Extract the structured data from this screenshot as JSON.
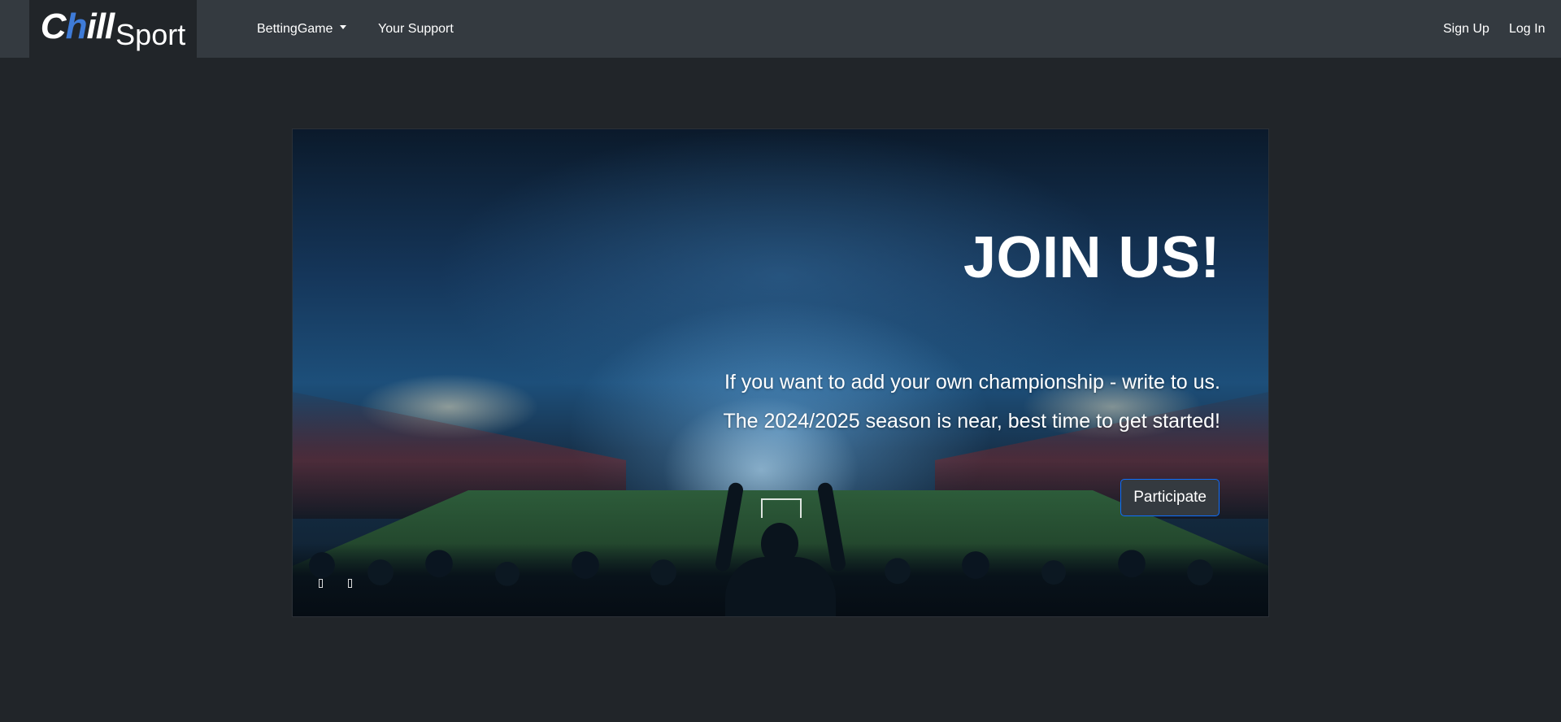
{
  "header": {
    "brand": {
      "chill_first": "C",
      "chill_accent": "h",
      "chill_rest": "ill",
      "sport": "Sport"
    },
    "nav": {
      "betting_game": "BettingGame",
      "your_support": "Your Support"
    },
    "auth": {
      "sign_up": "Sign Up",
      "log_in": "Log In"
    }
  },
  "hero": {
    "title": "JOIN US!",
    "line1": "If you want to add your own championship - write to us.",
    "line2": "The 2024/2025 season is near, best time to get started!",
    "button": "Participate",
    "controls": [
      "prev-control-icon",
      "next-control-icon"
    ]
  },
  "colors": {
    "page_background": "#212529",
    "navbar_background": "#343a40",
    "brand_background": "#212529",
    "brand_accent": "#3e7bd8",
    "button_border": "#0d6efd"
  }
}
